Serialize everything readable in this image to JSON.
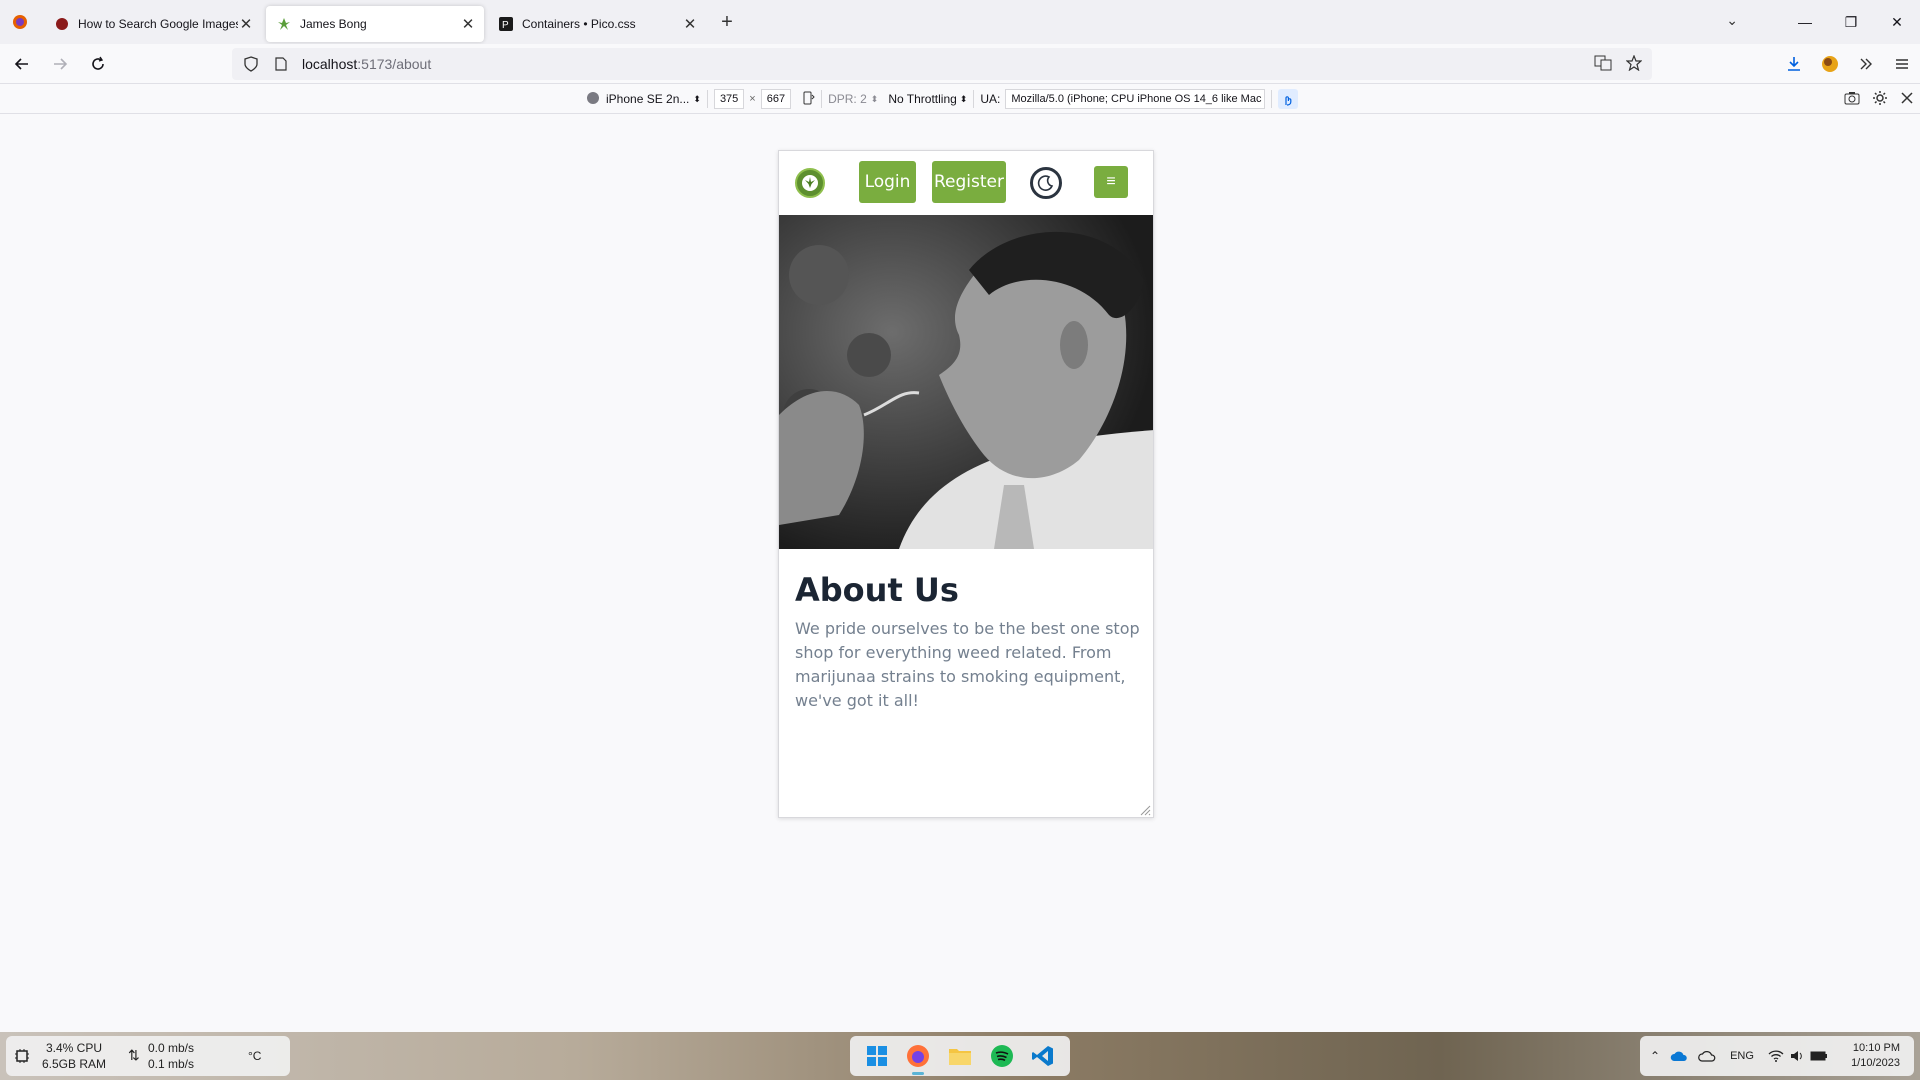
{
  "browser": {
    "tabs": [
      {
        "title": "How to Search Google Images f",
        "active": false
      },
      {
        "title": "James Bong",
        "active": true
      },
      {
        "title": "Containers • Pico.css",
        "active": false
      }
    ],
    "url_host": "localhost",
    "url_path": ":5173/about"
  },
  "rdm": {
    "device": "iPhone SE 2n...",
    "width": "375",
    "times": "×",
    "height": "667",
    "dpr": "DPR: 2",
    "throttling": "No Throttling",
    "ua_label": "UA:",
    "ua_value": "Mozilla/5.0 (iPhone; CPU iPhone OS 14_6 like Mac"
  },
  "site": {
    "login_label": "Login",
    "register_label": "Register",
    "hamburger_glyph": "≡",
    "about_title": "About Us",
    "about_text": "We pride ourselves to be the best one stop shop for everything weed related.  From marijunaa strains to smoking equipment, we've got it all!"
  },
  "taskbar": {
    "cpu": "3.4%  CPU",
    "ram": "6.5GB  RAM",
    "net_down": "0.0 mb/s",
    "net_up": "0.1 mb/s",
    "temp": "°C",
    "lang": "ENG",
    "time": "10:10 PM",
    "date": "1/10/2023"
  },
  "colors": {
    "accent_green": "#7aad3f",
    "title_dark": "#1b2533",
    "body_text": "#74808f"
  }
}
